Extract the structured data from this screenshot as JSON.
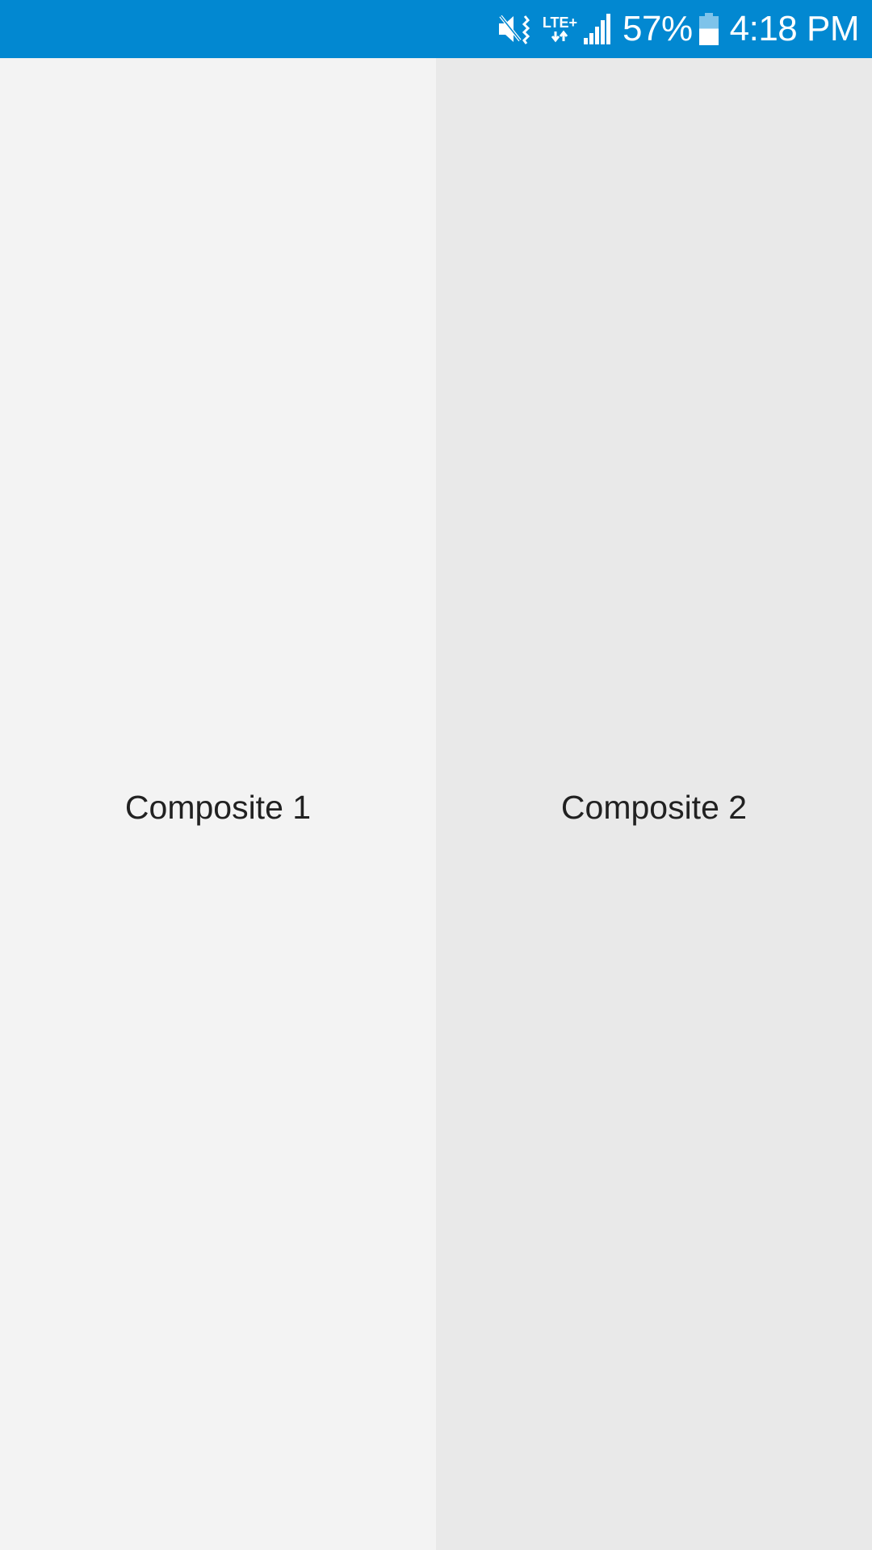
{
  "status_bar": {
    "background": "#0288D1",
    "icons": [
      "mute-vibrate-icon",
      "lte-data-icon",
      "signal-icon",
      "battery-icon"
    ],
    "network_label": "LTE+",
    "battery_percent": "57%",
    "battery_level": 0.57,
    "time": "4:18 PM"
  },
  "panes": [
    {
      "label": "Composite 1",
      "background": "#F3F3F3"
    },
    {
      "label": "Composite 2",
      "background": "#E9E9E9"
    }
  ]
}
